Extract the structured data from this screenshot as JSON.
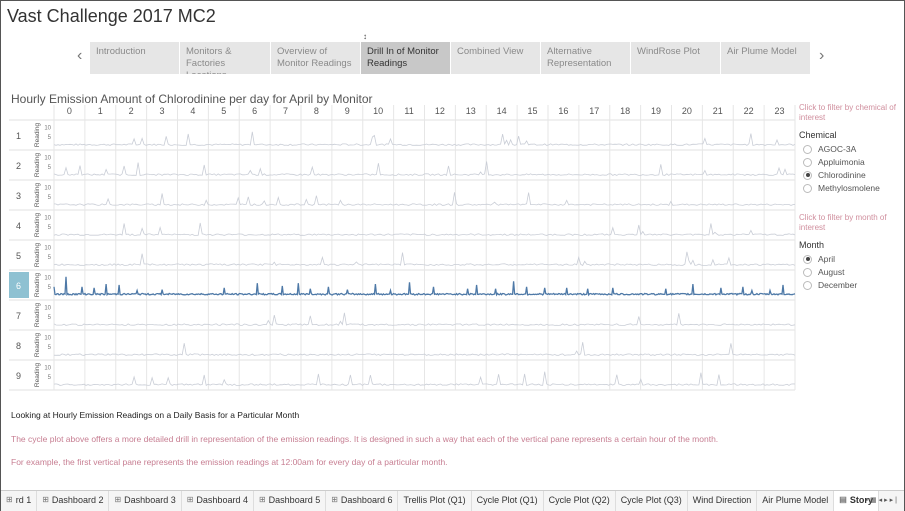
{
  "app": {
    "title": "Vast Challenge 2017 MC2"
  },
  "story": {
    "points": [
      {
        "label": "Introduction",
        "active": false
      },
      {
        "label": "Monitors &\nFactories Locations",
        "active": false
      },
      {
        "label": "Overview of\nMonitor Readings",
        "active": false
      },
      {
        "label": "Drill In of Monitor\nReadings",
        "active": true
      },
      {
        "label": "Combined View",
        "active": false
      },
      {
        "label": "Alternative\nRepresentation",
        "active": false
      },
      {
        "label": "WindRose Plot",
        "active": false
      },
      {
        "label": "Air Plume Model",
        "active": false
      }
    ]
  },
  "viz": {
    "title": "Hourly Emission Amount of Chlorodinine per day for April by Monitor",
    "hours": [
      "0",
      "1",
      "2",
      "3",
      "4",
      "5",
      "6",
      "7",
      "8",
      "9",
      "10",
      "11",
      "12",
      "13",
      "14",
      "15",
      "16",
      "17",
      "18",
      "19",
      "20",
      "21",
      "22",
      "23"
    ],
    "monitors": [
      "1",
      "2",
      "3",
      "4",
      "5",
      "6",
      "7",
      "8",
      "9"
    ],
    "selected_monitor": "6",
    "row_label": "Reading",
    "y_ticks": [
      "10",
      "5"
    ],
    "line_color": "#4e79a7",
    "faint_color": "#c9cdd6",
    "selected_bg": "#8ec1d2"
  },
  "chart_data": {
    "type": "line",
    "title": "Hourly Emission Amount of Chlorodinine per day for April by Monitor",
    "columns": "hour of day (0-23)",
    "rows": "monitor (1-9)",
    "ylabel": "Reading",
    "ylim": [
      0,
      12
    ],
    "highlighted_monitor": "6",
    "peak_positions": [
      {
        "hour": 0,
        "value": 5
      },
      {
        "hour": 0.4,
        "value": 10.5
      },
      {
        "hour": 0.9,
        "value": 5
      },
      {
        "hour": 1.3,
        "value": 4.5
      },
      {
        "hour": 1.7,
        "value": 6.5
      },
      {
        "hour": 2.1,
        "value": 6
      },
      {
        "hour": 2.7,
        "value": 3
      },
      {
        "hour": 3.5,
        "value": 3.5
      },
      {
        "hour": 5.5,
        "value": 4.5
      },
      {
        "hour": 6.6,
        "value": 7
      },
      {
        "hour": 7.4,
        "value": 5.5
      },
      {
        "hour": 7.9,
        "value": 7
      },
      {
        "hour": 8.3,
        "value": 4
      },
      {
        "hour": 8.9,
        "value": 5
      },
      {
        "hour": 9.5,
        "value": 3.5
      },
      {
        "hour": 10.4,
        "value": 6.5
      },
      {
        "hour": 10.9,
        "value": 3
      },
      {
        "hour": 11.5,
        "value": 7.5
      },
      {
        "hour": 12.3,
        "value": 5
      },
      {
        "hour": 13.4,
        "value": 4
      },
      {
        "hour": 13.7,
        "value": 6
      },
      {
        "hour": 14.3,
        "value": 4
      },
      {
        "hour": 14.9,
        "value": 8
      },
      {
        "hour": 15.3,
        "value": 5
      },
      {
        "hour": 15.9,
        "value": 4.5
      },
      {
        "hour": 16.6,
        "value": 4.5
      },
      {
        "hour": 17.3,
        "value": 4
      },
      {
        "hour": 18.1,
        "value": 4.5
      },
      {
        "hour": 19.8,
        "value": 4
      },
      {
        "hour": 20.7,
        "value": 6.5
      },
      {
        "hour": 21.6,
        "value": 4.5
      },
      {
        "hour": 22.3,
        "value": 5
      },
      {
        "hour": 22.6,
        "value": 3
      },
      {
        "hour": 23.2,
        "value": 3
      },
      {
        "hour": 23.6,
        "value": 6
      }
    ]
  },
  "filters": {
    "chemical_hint": "Click to filter by chemical of interest",
    "chemical_title": "Chemical",
    "chemicals": [
      {
        "label": "AGOC-3A",
        "selected": false
      },
      {
        "label": "Appluimonia",
        "selected": false
      },
      {
        "label": "Chlorodinine",
        "selected": true
      },
      {
        "label": "Methylosmolene",
        "selected": false
      }
    ],
    "month_hint": "Click to filter by month of interest",
    "month_title": "Month",
    "months": [
      {
        "label": "April",
        "selected": true
      },
      {
        "label": "August",
        "selected": false
      },
      {
        "label": "December",
        "selected": false
      }
    ]
  },
  "captions": {
    "heading": "Looking at Hourly Emission Readings on a Daily Basis for a Particular Month",
    "p1": "The cycle plot above offers a more detailed drill in representation of the emission readings. It is designed in such a way that each of the vertical pane represents a certain hour of the month.",
    "p2": "For example, the first vertical pane represents the emission readings at 12:00am for every day of a particular month."
  },
  "tabs": [
    {
      "label": "rd 1",
      "icon": "dashboard-icon",
      "active": false
    },
    {
      "label": "Dashboard 2",
      "icon": "dashboard-icon",
      "active": false
    },
    {
      "label": "Dashboard 3",
      "icon": "dashboard-icon",
      "active": false
    },
    {
      "label": "Dashboard 4",
      "icon": "dashboard-icon",
      "active": false
    },
    {
      "label": "Dashboard 5",
      "icon": "dashboard-icon",
      "active": false
    },
    {
      "label": "Dashboard 6",
      "icon": "dashboard-icon",
      "active": false
    },
    {
      "label": "Trellis Plot (Q1)",
      "icon": "",
      "active": false
    },
    {
      "label": "Cycle Plot (Q1)",
      "icon": "",
      "active": false
    },
    {
      "label": "Cycle Plot (Q2)",
      "icon": "",
      "active": false
    },
    {
      "label": "Cycle Plot (Q3)",
      "icon": "",
      "active": false
    },
    {
      "label": "Wind Direction",
      "icon": "",
      "active": false
    },
    {
      "label": "Air Plume Model",
      "icon": "",
      "active": false
    },
    {
      "label": "Story",
      "icon": "story-icon",
      "active": true
    }
  ]
}
